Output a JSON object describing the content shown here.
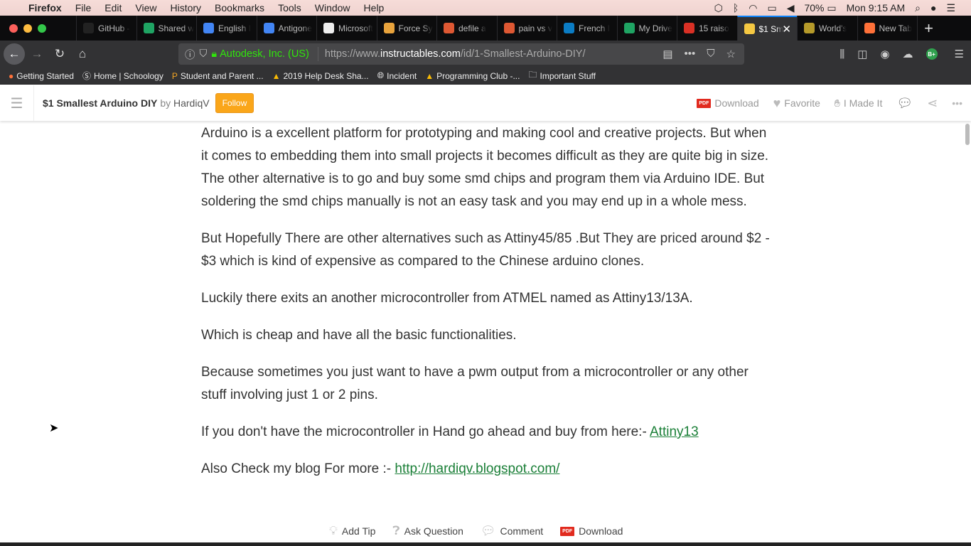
{
  "menubar": {
    "app": "Firefox",
    "items": [
      "File",
      "Edit",
      "View",
      "History",
      "Bookmarks",
      "Tools",
      "Window",
      "Help"
    ],
    "battery": "70%",
    "clock": "Mon 9:15 AM"
  },
  "tabs": [
    {
      "label": "GitHub - ",
      "icon": "github-icon",
      "color": "#222"
    },
    {
      "label": "Shared w",
      "icon": "google-drive-icon",
      "color": "#1fa463"
    },
    {
      "label": "English I",
      "icon": "google-docs-icon",
      "color": "#4285f4"
    },
    {
      "label": "Antigone",
      "icon": "google-docs-icon",
      "color": "#4285f4"
    },
    {
      "label": "Microsoft",
      "icon": "page-icon",
      "color": "#eee"
    },
    {
      "label": "Force Sy",
      "icon": "stack-icon",
      "color": "#e8a33c"
    },
    {
      "label": "defile a",
      "icon": "duckduckgo-icon",
      "color": "#de5833"
    },
    {
      "label": "pain vs v",
      "icon": "duckduckgo-icon",
      "color": "#de5833"
    },
    {
      "label": "French I",
      "icon": "schoology-icon",
      "color": "#0b7cc4"
    },
    {
      "label": "My Drive",
      "icon": "google-drive-icon",
      "color": "#1fa463"
    },
    {
      "label": "15 raiso",
      "icon": "app-icon",
      "color": "#d93025"
    },
    {
      "label": "$1 Sm",
      "icon": "instructables-icon",
      "color": "#f5c842",
      "active": true
    },
    {
      "label": "World's",
      "icon": "frog-icon",
      "color": "#b59a2a"
    },
    {
      "label": "New Tab",
      "icon": "firefox-icon",
      "color": "#ff7139"
    }
  ],
  "url": {
    "identity": "Autodesk, Inc. (US)",
    "prefix": "https://www.",
    "host": "instructables.com",
    "path": "/id/1-Smallest-Arduino-DIY/"
  },
  "bookmarks": [
    "Getting Started",
    "Home | Schoology",
    "Student and Parent ...",
    "2019 Help Desk Sha...",
    "Incident",
    "Programming Club -...",
    "Important Stuff"
  ],
  "header": {
    "title": "$1 Smallest Arduino DIY",
    "by": "by",
    "author": "HardiqV",
    "follow": "Follow",
    "download": "Download",
    "favorite": "Favorite",
    "made_it": "I Made It",
    "pdf": "PDF"
  },
  "content": {
    "p1": "Arduino is a excellent platform for prototyping and making cool and creative projects. But when it comes to embedding them into small projects it becomes difficult as they are quite big in size. The other alternative is to go and buy some smd chips and program them via Arduino IDE. But soldering the smd chips manually is not an easy task and you may end up in a whole mess.",
    "p2": "But Hopefully There are other alternatives such as Attiny45/85 .But They are priced around $2 - $3 which is kind of expensive as compared to the Chinese arduino clones.",
    "p3": "Luckily there exits an another microcontroller from ATMEL named as Attiny13/13A.",
    "p4": "Which is cheap and have all the basic functionalities.",
    "p5": "Because sometimes you just want to have a pwm output from a microcontroller or any other stuff involving just 1 or 2 pins.",
    "p6": "If you don't have the microcontroller in Hand go ahead and buy from here:- ",
    "p6_link": "Attiny13",
    "p7": "Also Check my blog For more :- ",
    "p7_link": "http://hardiqv.blogspot.com/"
  },
  "footer": {
    "add_tip": "Add Tip",
    "ask": "Ask Question",
    "comment": "Comment",
    "download": "Download",
    "pdf": "PDF"
  }
}
